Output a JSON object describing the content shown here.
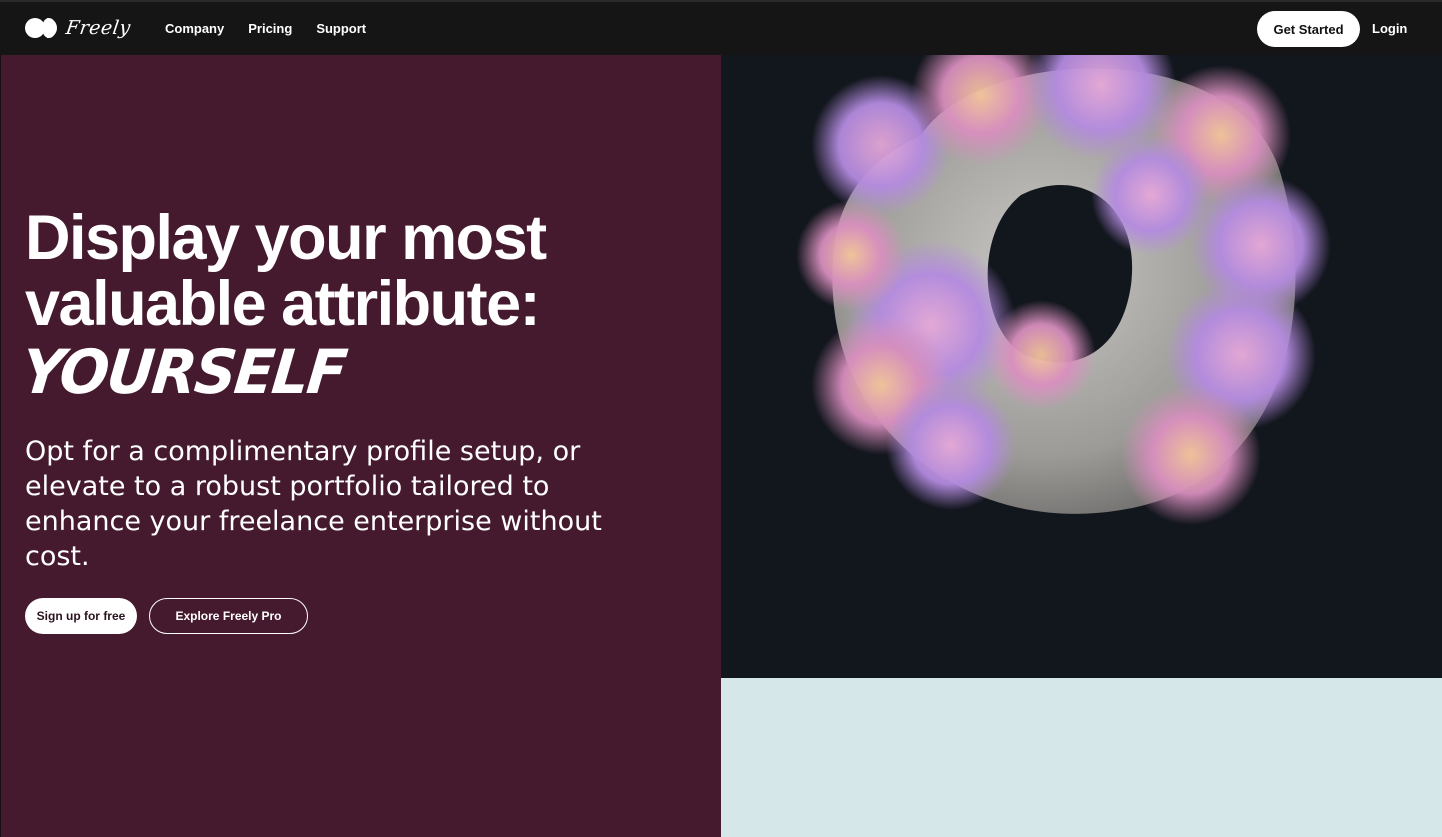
{
  "header": {
    "brand": "Freely",
    "nav": [
      "Company",
      "Pricing",
      "Support"
    ],
    "cta_label": "Get Started",
    "login_label": "Login"
  },
  "hero": {
    "headline_line1": "Display your most",
    "headline_line2": "valuable attribute:",
    "script_word": "YOURSELF",
    "subcopy": "Opt for a complimentary profile setup, or elevate to a robust portfolio tailored to enhance your freelance enterprise without cost.",
    "primary_cta": "Sign up for free",
    "secondary_cta": "Explore Freely Pro"
  },
  "colors": {
    "hero_left_bg": "#451a2e",
    "hero_right_bg": "#12161d",
    "lower_panel_bg": "#d6e7ea",
    "topbar_bg": "#151515"
  },
  "icons": [
    "freely-logo-mark-icon"
  ]
}
